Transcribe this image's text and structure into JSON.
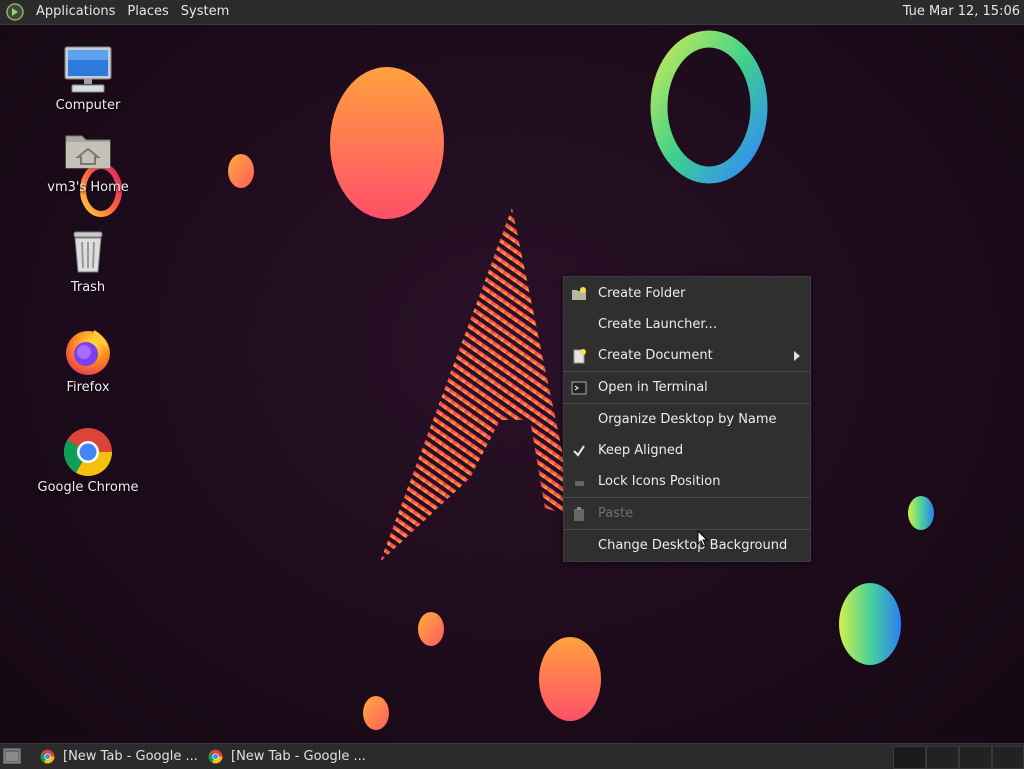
{
  "top_panel": {
    "menus": [
      "Applications",
      "Places",
      "System"
    ],
    "clock": "Tue Mar 12, 15:06"
  },
  "desktop_icons": [
    {
      "label": "Computer",
      "icon": "computer-icon"
    },
    {
      "label": "vm3's Home",
      "icon": "home-folder-icon"
    },
    {
      "label": "Trash",
      "icon": "trash-icon"
    },
    {
      "label": "Firefox",
      "icon": "firefox-icon"
    },
    {
      "label": "Google Chrome",
      "icon": "chrome-icon"
    }
  ],
  "context_menu": {
    "items": [
      {
        "label": "Create Folder",
        "icon": "folder-new-icon"
      },
      {
        "label": "Create Launcher..."
      },
      {
        "label": "Create Document",
        "icon": "document-new-icon",
        "submenu": true
      },
      {
        "label": "Open in Terminal",
        "icon": "terminal-icon"
      },
      {
        "label": "Organize Desktop by Name"
      },
      {
        "label": "Keep Aligned",
        "checked": true
      },
      {
        "label": "Lock Icons Position",
        "icon": "lock-icon"
      },
      {
        "label": "Paste",
        "icon": "paste-icon",
        "disabled": true
      },
      {
        "label": "Change Desktop Background"
      }
    ]
  },
  "taskbar": {
    "tasks": [
      {
        "label": "[New Tab - Google ...",
        "icon": "chrome-icon"
      },
      {
        "label": "[New Tab - Google ...",
        "icon": "chrome-icon"
      }
    ]
  },
  "colors": {
    "panel_bg": "#2b2b2b",
    "desktop_bg": "#1e0d1c",
    "menu_bg": "#2f2f2f",
    "accent_orange": "#ff7a3c",
    "accent_pink": "#e8306e"
  }
}
